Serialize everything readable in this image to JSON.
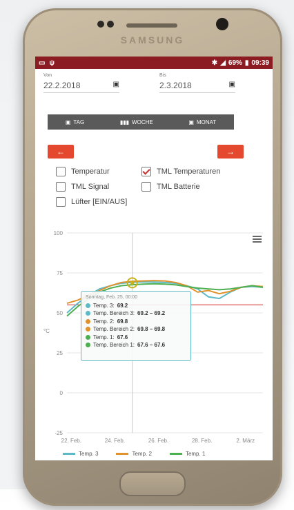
{
  "device": {
    "brand": "SAMSUNG"
  },
  "status_bar": {
    "battery": "69%",
    "time": "09:39"
  },
  "date_range": {
    "from_label": "Von",
    "from_value": "22.2.2018",
    "to_label": "Bis",
    "to_value": "2.3.2018"
  },
  "period": {
    "day": "TAG",
    "week": "WOCHE",
    "month": "MONAT"
  },
  "nav": {
    "prev": "←",
    "next": "→"
  },
  "options": {
    "temperatur": {
      "label": "Temperatur",
      "checked": false
    },
    "tml_temperaturen": {
      "label": "TML Temperaturen",
      "checked": true
    },
    "tml_signal": {
      "label": "TML Signal",
      "checked": false
    },
    "tml_batterie": {
      "label": "TML Batterie",
      "checked": false
    },
    "luefter": {
      "label": "Lüfter [EIN/AUS]",
      "checked": false
    }
  },
  "chart_data": {
    "type": "line",
    "ylabel": "°C",
    "ylim": [
      -25,
      100
    ],
    "yticks": [
      "100",
      "75",
      "50",
      "25",
      "0",
      "-25"
    ],
    "xticks": [
      "22. Feb.",
      "24. Feb.",
      "26. Feb.",
      "28. Feb.",
      "2. März"
    ],
    "series": [
      {
        "name": "Temp. 3",
        "color": "#5bbac6",
        "x": [
          0,
          0.5,
          1,
          1.5,
          2,
          2.5,
          3,
          3.5,
          4,
          4.5,
          5,
          5.5,
          6,
          6.5,
          7,
          7.5,
          8,
          8.5,
          9
        ],
        "values": [
          50,
          56,
          61,
          65,
          67,
          68.5,
          69.2,
          69.4,
          69.3,
          69,
          68.5,
          67,
          65,
          60,
          59,
          63,
          66,
          66.5,
          66
        ]
      },
      {
        "name": "Temp. 2",
        "color": "#e0922c",
        "x": [
          0,
          0.5,
          1,
          1.5,
          2,
          2.5,
          3,
          3.5,
          4,
          4.5,
          5,
          5.5,
          6,
          6.5,
          7,
          7.5,
          8,
          8.5,
          9
        ],
        "values": [
          56,
          58,
          61,
          64,
          67,
          69,
          69.8,
          70,
          70.2,
          70,
          69,
          67,
          63,
          64,
          62,
          63.5,
          66,
          67,
          66.5
        ]
      },
      {
        "name": "Temp. 1",
        "color": "#4caf50",
        "x": [
          0,
          0.5,
          1,
          1.5,
          2,
          2.5,
          3,
          3.5,
          4,
          4.5,
          5,
          5.5,
          6,
          6.5,
          7,
          7.5,
          8,
          8.5,
          9
        ],
        "values": [
          48,
          54,
          59,
          63,
          65.5,
          67,
          67.6,
          68,
          68.2,
          68,
          67.5,
          66.5,
          65.5,
          65,
          64.5,
          65,
          66,
          67,
          66
        ]
      }
    ],
    "threshold": {
      "value": 55,
      "color": "#d9534f"
    },
    "grid": true,
    "tooltip": {
      "header": "Sonntag, Feb. 25, 00:00",
      "rows": [
        {
          "color": "#5bbac6",
          "label": "Temp. 3:",
          "value": "69.2"
        },
        {
          "color": "#5bbac6",
          "label": "Temp. Bereich 3:",
          "value": "69.2 – 69.2"
        },
        {
          "color": "#e0922c",
          "label": "Temp. 2:",
          "value": "69.8"
        },
        {
          "color": "#e0922c",
          "label": "Temp. Bereich 2:",
          "value": "69.8 – 69.8"
        },
        {
          "color": "#4caf50",
          "label": "Temp. 1:",
          "value": "67.6"
        },
        {
          "color": "#4caf50",
          "label": "Temp. Bereich 1:",
          "value": "67.6 – 67.6"
        }
      ]
    },
    "legend": [
      "Temp. 3",
      "Temp. 2",
      "Temp. 1"
    ]
  }
}
